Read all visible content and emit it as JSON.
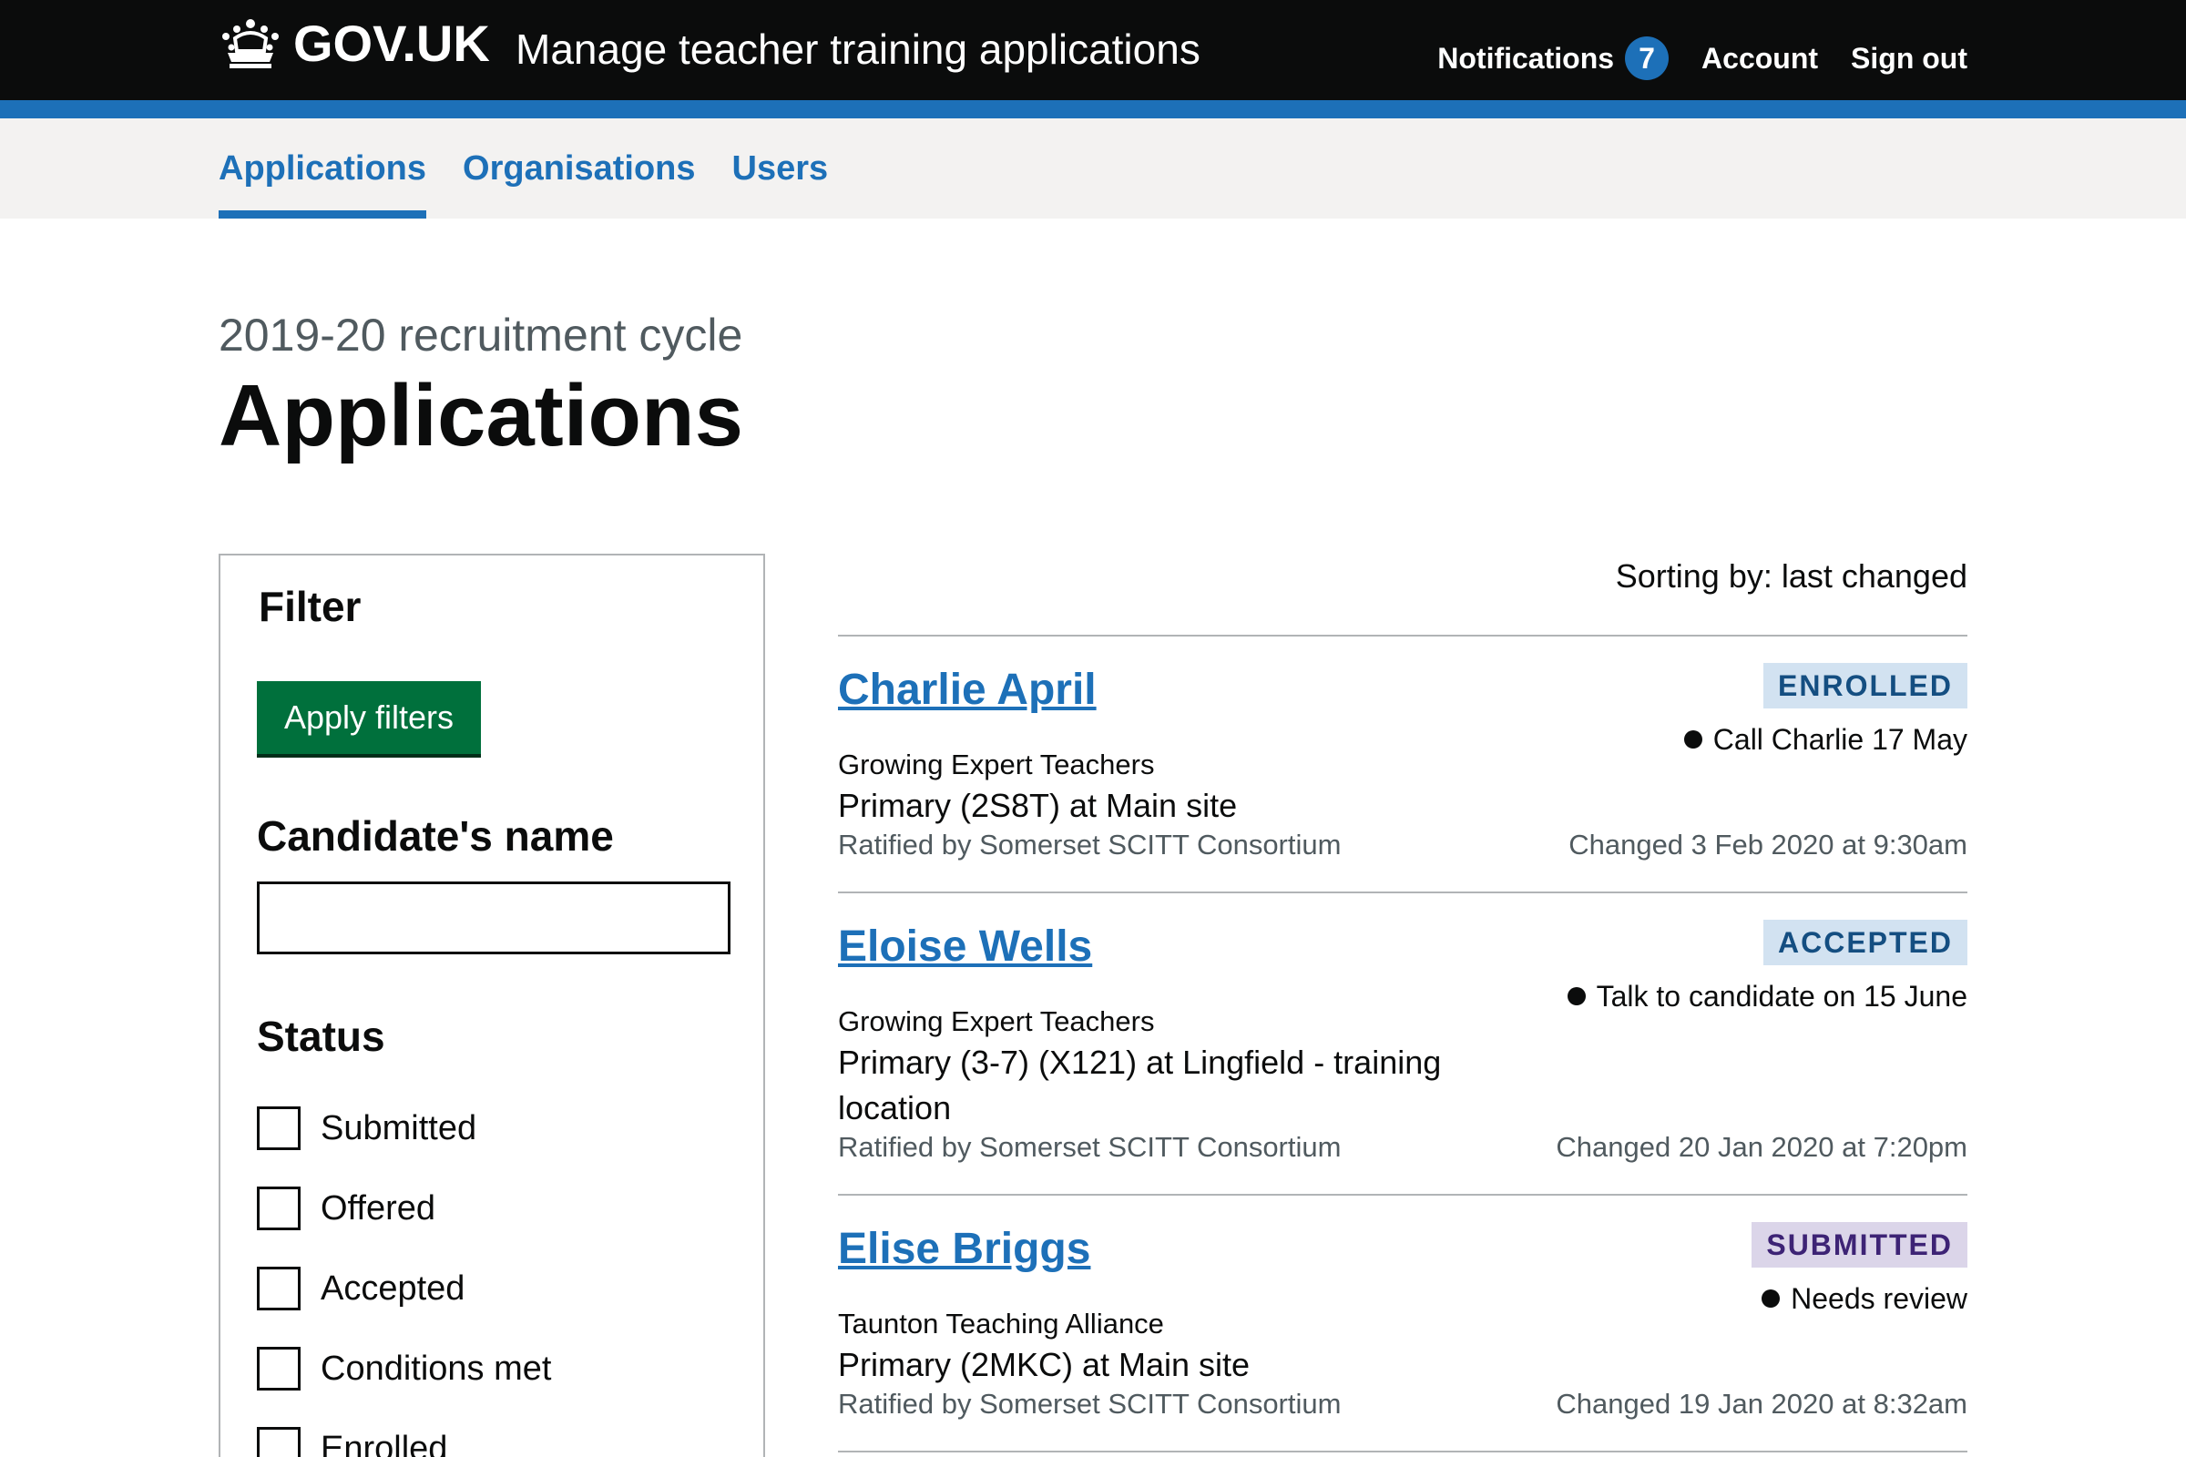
{
  "header": {
    "logo_text": "GOV.UK",
    "service_name": "Manage teacher training applications",
    "notifications_label": "Notifications",
    "notifications_count": "7",
    "account_label": "Account",
    "sign_out_label": "Sign out"
  },
  "subnav": {
    "items": [
      {
        "label": "Applications",
        "active": true
      },
      {
        "label": "Organisations",
        "active": false
      },
      {
        "label": "Users",
        "active": false
      }
    ]
  },
  "page": {
    "caption": "2019-20 recruitment cycle",
    "title": "Applications"
  },
  "filter": {
    "title": "Filter",
    "apply_label": "Apply filters",
    "name_label": "Candidate's name",
    "name_value": "",
    "status_label": "Status",
    "statuses": [
      "Submitted",
      "Offered",
      "Accepted",
      "Conditions met",
      "Enrolled"
    ]
  },
  "results": {
    "sorting": "Sorting by: last changed",
    "applications": [
      {
        "name": "Charlie April",
        "status": "ENROLLED",
        "note": "Call Charlie 17 May",
        "provider": "Growing Expert Teachers",
        "course": "Primary (2S8T) at Main site",
        "ratified": "Ratified by Somerset SCITT Consortium",
        "changed": "Changed 3 Feb 2020 at 9:30am"
      },
      {
        "name": "Eloise Wells",
        "status": "ACCEPTED",
        "note": "Talk to candidate on 15 June",
        "provider": "Growing Expert Teachers",
        "course": "Primary (3-7) (X121) at Lingfield - training location",
        "ratified": "Ratified by Somerset SCITT Consortium",
        "changed": "Changed 20 Jan 2020 at 7:20pm"
      },
      {
        "name": "Elise Briggs",
        "status": "SUBMITTED",
        "note": "Needs review",
        "provider": "Taunton Teaching Alliance",
        "course": "Primary (2MKC) at Main site",
        "ratified": "Ratified by Somerset SCITT Consortium",
        "changed": "Changed 19 Jan 2020 at 8:32am"
      }
    ]
  }
}
